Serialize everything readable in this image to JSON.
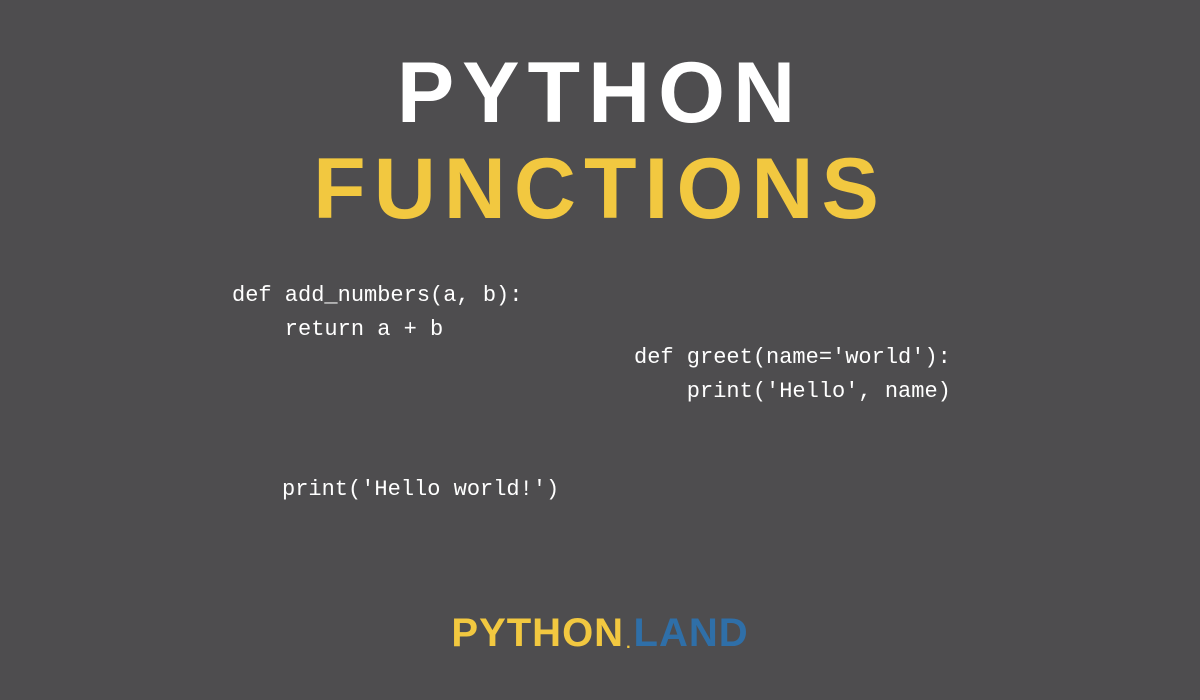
{
  "title": {
    "line1": "PYTHON",
    "line2": "FUNCTIONS"
  },
  "code": {
    "left": "def add_numbers(a, b):\n    return a + b",
    "right": "def greet(name='world'):\n    print('Hello', name)",
    "bottom": "print('Hello world!')"
  },
  "logo": {
    "part1": "PYTHON",
    "dot": ".",
    "part2": "LAND"
  },
  "colors": {
    "background": "#4e4d4f",
    "white": "#ffffff",
    "yellow": "#f2c840",
    "blue": "#2f6fa8"
  }
}
